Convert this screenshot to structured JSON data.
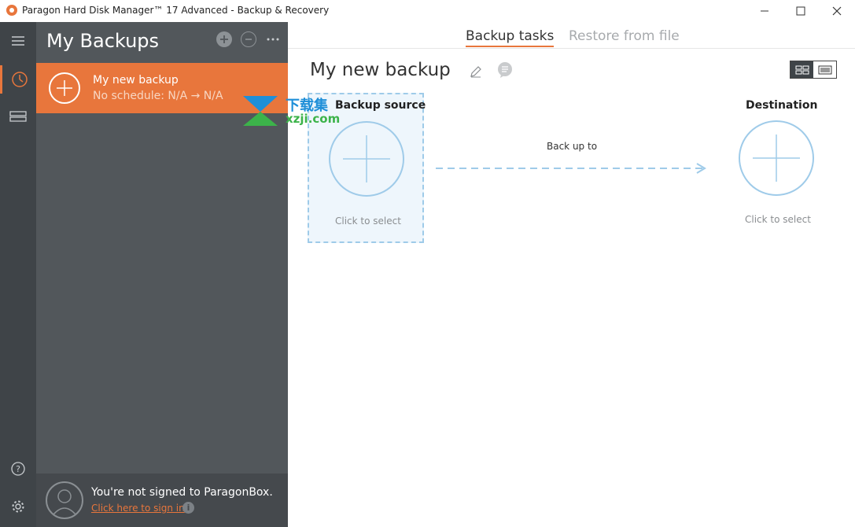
{
  "window": {
    "title": "Paragon Hard Disk Manager™ 17 Advanced - Backup & Recovery",
    "minimize": "—",
    "maximize": "☐",
    "close": "✕"
  },
  "rail": {
    "icons": [
      "menu-icon",
      "backup-clock-icon",
      "drives-icon",
      "help-icon",
      "settings-icon"
    ]
  },
  "sidebar": {
    "title": "My Backups",
    "tools": {
      "add": "+",
      "remove": "−",
      "more": "···"
    },
    "items": [
      {
        "name": "My new backup",
        "schedule": "No schedule: N/A → N/A"
      }
    ],
    "signin": {
      "message": "You're not signed to ParagonBox.",
      "link": "Click here to sign in",
      "info": "i"
    }
  },
  "main": {
    "tabs": [
      {
        "label": "Backup tasks",
        "active": true
      },
      {
        "label": "Restore from file",
        "active": false
      }
    ],
    "backup_title": "My new backup",
    "source": {
      "label": "Backup source",
      "hint": "Click to select"
    },
    "arrow": {
      "label": "Back up to"
    },
    "destination": {
      "label": "Destination",
      "hint": "Click to select"
    }
  },
  "watermark": {
    "text": "下载集",
    "url": "xzji.com"
  },
  "colors": {
    "accent": "#e8763c",
    "rail": "#3f4448",
    "sidebar": "#52575b",
    "circle": "#9fcbe9"
  }
}
